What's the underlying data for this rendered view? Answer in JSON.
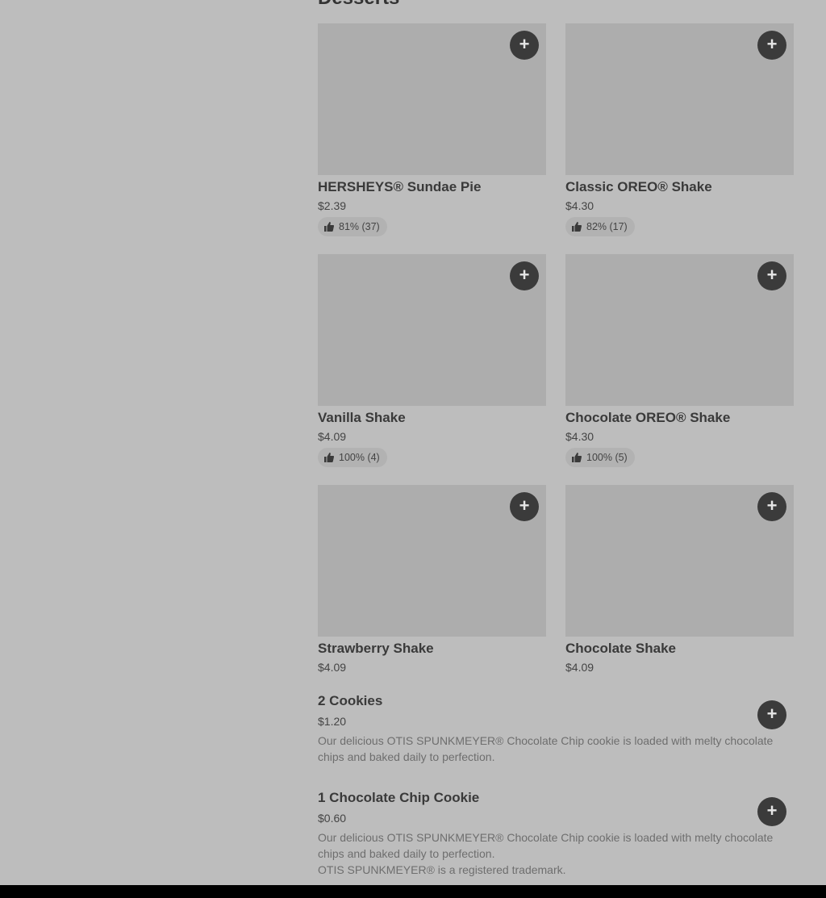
{
  "section": {
    "title": "Desserts"
  },
  "cards": [
    {
      "name": "HERSHEYS® Sundae Pie",
      "price": "$2.39",
      "rating": "81% (37)"
    },
    {
      "name": "Classic OREO® Shake",
      "price": "$4.30",
      "rating": "82% (17)"
    },
    {
      "name": "Vanilla Shake",
      "price": "$4.09",
      "rating": "100% (4)"
    },
    {
      "name": "Chocolate OREO® Shake",
      "price": "$4.30",
      "rating": "100% (5)"
    },
    {
      "name": "Strawberry Shake",
      "price": "$4.09"
    },
    {
      "name": "Chocolate Shake",
      "price": "$4.09"
    }
  ],
  "list": [
    {
      "name": "2 Cookies",
      "price": "$1.20",
      "desc1": "Our delicious OTIS SPUNKMEYER® Chocolate Chip cookie is loaded with melty chocolate chips and baked daily to perfection."
    },
    {
      "name": "1 Chocolate Chip Cookie",
      "price": "$0.60",
      "desc1": "Our delicious OTIS SPUNKMEYER® Chocolate Chip cookie is loaded with melty chocolate chips and baked daily to perfection.",
      "desc2": "OTIS SPUNKMEYER® is a registered trademark."
    }
  ],
  "icons": {
    "add": "plus-icon",
    "rating": "thumbs-up-icon"
  },
  "add_symbol": "+"
}
